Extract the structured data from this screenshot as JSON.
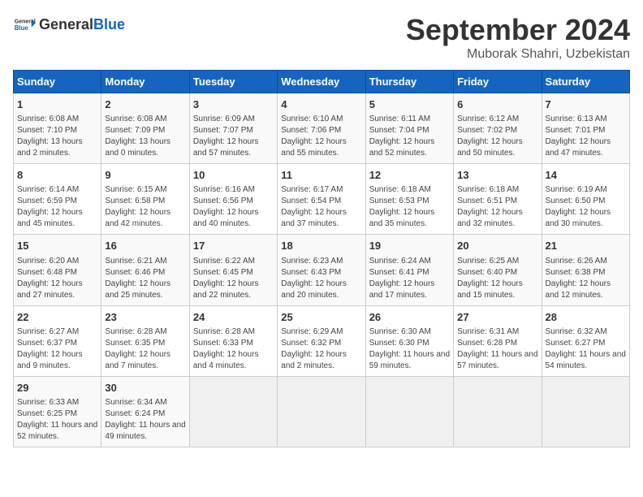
{
  "header": {
    "logo_general": "General",
    "logo_blue": "Blue",
    "month_year": "September 2024",
    "location": "Muborak Shahri, Uzbekistan"
  },
  "weekdays": [
    "Sunday",
    "Monday",
    "Tuesday",
    "Wednesday",
    "Thursday",
    "Friday",
    "Saturday"
  ],
  "weeks": [
    [
      {
        "day": "1",
        "info": "Sunrise: 6:08 AM\nSunset: 7:10 PM\nDaylight: 13 hours and 2 minutes."
      },
      {
        "day": "2",
        "info": "Sunrise: 6:08 AM\nSunset: 7:09 PM\nDaylight: 13 hours and 0 minutes."
      },
      {
        "day": "3",
        "info": "Sunrise: 6:09 AM\nSunset: 7:07 PM\nDaylight: 12 hours and 57 minutes."
      },
      {
        "day": "4",
        "info": "Sunrise: 6:10 AM\nSunset: 7:06 PM\nDaylight: 12 hours and 55 minutes."
      },
      {
        "day": "5",
        "info": "Sunrise: 6:11 AM\nSunset: 7:04 PM\nDaylight: 12 hours and 52 minutes."
      },
      {
        "day": "6",
        "info": "Sunrise: 6:12 AM\nSunset: 7:02 PM\nDaylight: 12 hours and 50 minutes."
      },
      {
        "day": "7",
        "info": "Sunrise: 6:13 AM\nSunset: 7:01 PM\nDaylight: 12 hours and 47 minutes."
      }
    ],
    [
      {
        "day": "8",
        "info": "Sunrise: 6:14 AM\nSunset: 6:59 PM\nDaylight: 12 hours and 45 minutes."
      },
      {
        "day": "9",
        "info": "Sunrise: 6:15 AM\nSunset: 6:58 PM\nDaylight: 12 hours and 42 minutes."
      },
      {
        "day": "10",
        "info": "Sunrise: 6:16 AM\nSunset: 6:56 PM\nDaylight: 12 hours and 40 minutes."
      },
      {
        "day": "11",
        "info": "Sunrise: 6:17 AM\nSunset: 6:54 PM\nDaylight: 12 hours and 37 minutes."
      },
      {
        "day": "12",
        "info": "Sunrise: 6:18 AM\nSunset: 6:53 PM\nDaylight: 12 hours and 35 minutes."
      },
      {
        "day": "13",
        "info": "Sunrise: 6:18 AM\nSunset: 6:51 PM\nDaylight: 12 hours and 32 minutes."
      },
      {
        "day": "14",
        "info": "Sunrise: 6:19 AM\nSunset: 6:50 PM\nDaylight: 12 hours and 30 minutes."
      }
    ],
    [
      {
        "day": "15",
        "info": "Sunrise: 6:20 AM\nSunset: 6:48 PM\nDaylight: 12 hours and 27 minutes."
      },
      {
        "day": "16",
        "info": "Sunrise: 6:21 AM\nSunset: 6:46 PM\nDaylight: 12 hours and 25 minutes."
      },
      {
        "day": "17",
        "info": "Sunrise: 6:22 AM\nSunset: 6:45 PM\nDaylight: 12 hours and 22 minutes."
      },
      {
        "day": "18",
        "info": "Sunrise: 6:23 AM\nSunset: 6:43 PM\nDaylight: 12 hours and 20 minutes."
      },
      {
        "day": "19",
        "info": "Sunrise: 6:24 AM\nSunset: 6:41 PM\nDaylight: 12 hours and 17 minutes."
      },
      {
        "day": "20",
        "info": "Sunrise: 6:25 AM\nSunset: 6:40 PM\nDaylight: 12 hours and 15 minutes."
      },
      {
        "day": "21",
        "info": "Sunrise: 6:26 AM\nSunset: 6:38 PM\nDaylight: 12 hours and 12 minutes."
      }
    ],
    [
      {
        "day": "22",
        "info": "Sunrise: 6:27 AM\nSunset: 6:37 PM\nDaylight: 12 hours and 9 minutes."
      },
      {
        "day": "23",
        "info": "Sunrise: 6:28 AM\nSunset: 6:35 PM\nDaylight: 12 hours and 7 minutes."
      },
      {
        "day": "24",
        "info": "Sunrise: 6:28 AM\nSunset: 6:33 PM\nDaylight: 12 hours and 4 minutes."
      },
      {
        "day": "25",
        "info": "Sunrise: 6:29 AM\nSunset: 6:32 PM\nDaylight: 12 hours and 2 minutes."
      },
      {
        "day": "26",
        "info": "Sunrise: 6:30 AM\nSunset: 6:30 PM\nDaylight: 11 hours and 59 minutes."
      },
      {
        "day": "27",
        "info": "Sunrise: 6:31 AM\nSunset: 6:28 PM\nDaylight: 11 hours and 57 minutes."
      },
      {
        "day": "28",
        "info": "Sunrise: 6:32 AM\nSunset: 6:27 PM\nDaylight: 11 hours and 54 minutes."
      }
    ],
    [
      {
        "day": "29",
        "info": "Sunrise: 6:33 AM\nSunset: 6:25 PM\nDaylight: 11 hours and 52 minutes."
      },
      {
        "day": "30",
        "info": "Sunrise: 6:34 AM\nSunset: 6:24 PM\nDaylight: 11 hours and 49 minutes."
      },
      {
        "day": "",
        "info": ""
      },
      {
        "day": "",
        "info": ""
      },
      {
        "day": "",
        "info": ""
      },
      {
        "day": "",
        "info": ""
      },
      {
        "day": "",
        "info": ""
      }
    ]
  ]
}
